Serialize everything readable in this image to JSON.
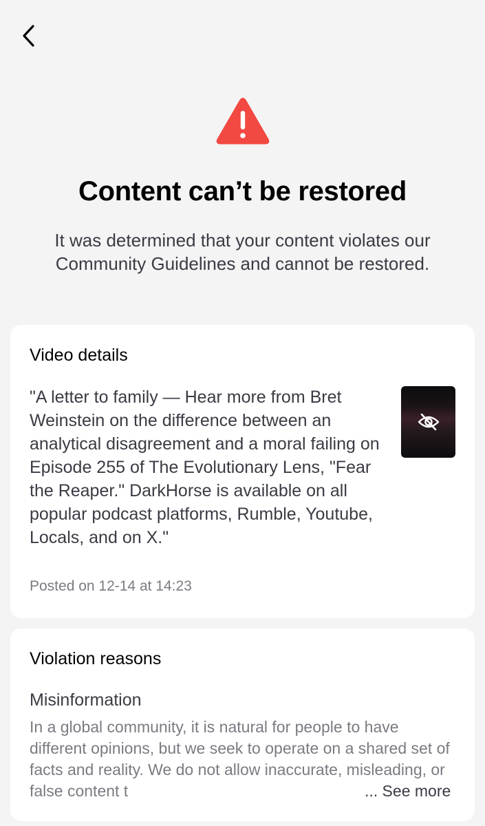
{
  "nav": {
    "back_icon": "chevron-left-icon"
  },
  "header": {
    "icon": "warning-triangle-icon",
    "icon_color": "#fe2c55",
    "title": "Content can’t be restored",
    "subtitle": "It was determined that your content violates our Community Guidelines and cannot be restored."
  },
  "video_details": {
    "heading": "Video details",
    "description": "\"A letter to family — Hear more from Bret Weinstein on the difference between an analytical disagreement and a moral failing on Episode 255 of The Evolutionary Lens, \"Fear the Reaper.\" DarkHorse is available on all popular podcast platforms, Rumble, Youtube, Locals, and on X.\"",
    "posted": "Posted on 12-14 at 14:23",
    "thumbnail_icon": "eye-slash-icon"
  },
  "violation": {
    "heading": "Violation reasons",
    "reason": "Misinformation",
    "description": "In a global community, it is natural for people to have different opinions, but we seek to operate on a shared set of facts and reality. We do not allow inaccurate, misleading, or false content t",
    "see_more_label": "... See more"
  }
}
